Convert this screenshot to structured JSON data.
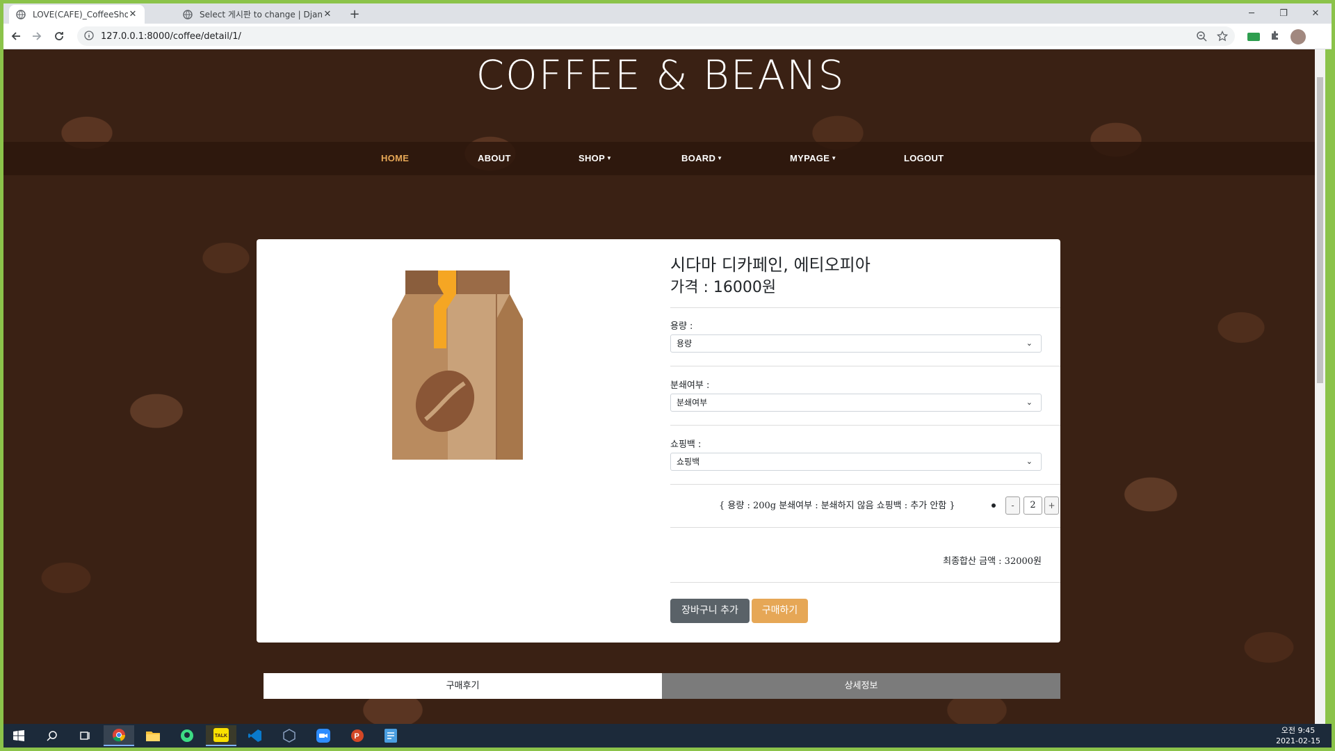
{
  "browser": {
    "tabs": [
      {
        "title": "LOVE(CAFE)_CoffeeShop",
        "active": true
      },
      {
        "title": "Select 게시판 to change | Djang",
        "active": false
      }
    ],
    "url": "127.0.0.1:8000/coffee/detail/1/"
  },
  "site": {
    "title": "COFFEE & BEANS",
    "nav": {
      "home": "HOME",
      "about": "ABOUT",
      "shop": "SHOP",
      "board": "BOARD",
      "mypage": "MYPAGE",
      "logout": "LOGOUT"
    }
  },
  "product": {
    "name": "시다마 디카페인, 에티오피아",
    "price_label": "가격 : 16000원",
    "options": [
      {
        "label": "용량 :",
        "selected": "용량"
      },
      {
        "label": "분쇄여부 :",
        "selected": "분쇄여부"
      },
      {
        "label": "쇼핑백 :",
        "selected": "쇼핑백"
      }
    ],
    "summary": "{ 용량 : 200g 분쇄여부 : 분쇄하지 않음 쇼핑백 : 추가 안함 }",
    "qty_minus": "-",
    "qty_plus": "+",
    "quantity": "2",
    "total": "최종합산 금액 : 32000원",
    "add_to_cart": "장바구니 추가",
    "buy": "구매하기"
  },
  "bottom_tabs": {
    "review": "구매후기",
    "info": "상세정보"
  },
  "taskbar": {
    "time": "오전 9:45",
    "date": "2021-02-15"
  },
  "colors": {
    "accent": "#e6a756",
    "navbar": "#2d160c",
    "cart_button": "#5a6268"
  }
}
